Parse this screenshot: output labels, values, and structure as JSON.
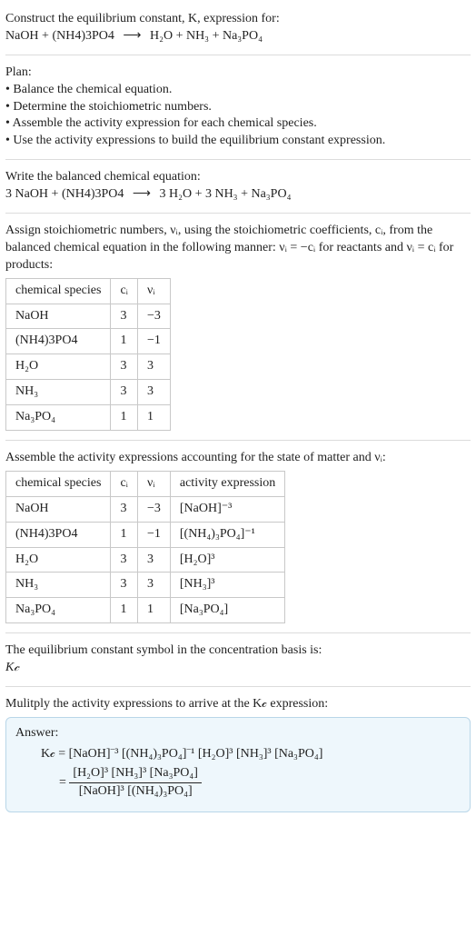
{
  "intro": {
    "line1": "Construct the equilibrium constant, K, expression for:",
    "equation_lhs": "NaOH + (NH4)3PO4",
    "equation_rhs": "H₂O + NH₃ + Na₃PO₄"
  },
  "plan": {
    "heading": "Plan:",
    "items": [
      "• Balance the chemical equation.",
      "• Determine the stoichiometric numbers.",
      "• Assemble the activity expression for each chemical species.",
      "• Use the activity expressions to build the equilibrium constant expression."
    ]
  },
  "balanced": {
    "heading": "Write the balanced chemical equation:",
    "lhs": "3 NaOH + (NH4)3PO4",
    "rhs": "3 H₂O + 3 NH₃ + Na₃PO₄"
  },
  "assign": {
    "text_a": "Assign stoichiometric numbers, νᵢ, using the stoichiometric coefficients, cᵢ, from the balanced chemical equation in the following manner: νᵢ = −cᵢ for reactants and νᵢ = cᵢ for products:",
    "headers": [
      "chemical species",
      "cᵢ",
      "νᵢ"
    ],
    "rows": [
      {
        "species": "NaOH",
        "c": "3",
        "v": "−3"
      },
      {
        "species": "(NH4)3PO4",
        "c": "1",
        "v": "−1"
      },
      {
        "species": "H₂O",
        "c": "3",
        "v": "3"
      },
      {
        "species": "NH₃",
        "c": "3",
        "v": "3"
      },
      {
        "species": "Na₃PO₄",
        "c": "1",
        "v": "1"
      }
    ]
  },
  "activity": {
    "text": "Assemble the activity expressions accounting for the state of matter and νᵢ:",
    "headers": [
      "chemical species",
      "cᵢ",
      "νᵢ",
      "activity expression"
    ],
    "rows": [
      {
        "species": "NaOH",
        "c": "3",
        "v": "−3",
        "expr": "[NaOH]⁻³"
      },
      {
        "species": "(NH4)3PO4",
        "c": "1",
        "v": "−1",
        "expr": "[(NH₄)₃PO₄]⁻¹"
      },
      {
        "species": "H₂O",
        "c": "3",
        "v": "3",
        "expr": "[H₂O]³"
      },
      {
        "species": "NH₃",
        "c": "3",
        "v": "3",
        "expr": "[NH₃]³"
      },
      {
        "species": "Na₃PO₄",
        "c": "1",
        "v": "1",
        "expr": "[Na₃PO₄]"
      }
    ]
  },
  "symbol": {
    "line1": "The equilibrium constant symbol in the concentration basis is:",
    "line2": "K𝒸"
  },
  "multiply": {
    "text": "Mulitply the activity expressions to arrive at the K𝒸 expression:"
  },
  "answer": {
    "label": "Answer:",
    "line1": "K𝒸 = [NaOH]⁻³ [(NH₄)₃PO₄]⁻¹ [H₂O]³ [NH₃]³ [Na₃PO₄]",
    "frac_num": "[H₂O]³ [NH₃]³ [Na₃PO₄]",
    "frac_den": "[NaOH]³ [(NH₄)₃PO₄]",
    "eq_prefix": "= "
  },
  "arrow": "⟶"
}
